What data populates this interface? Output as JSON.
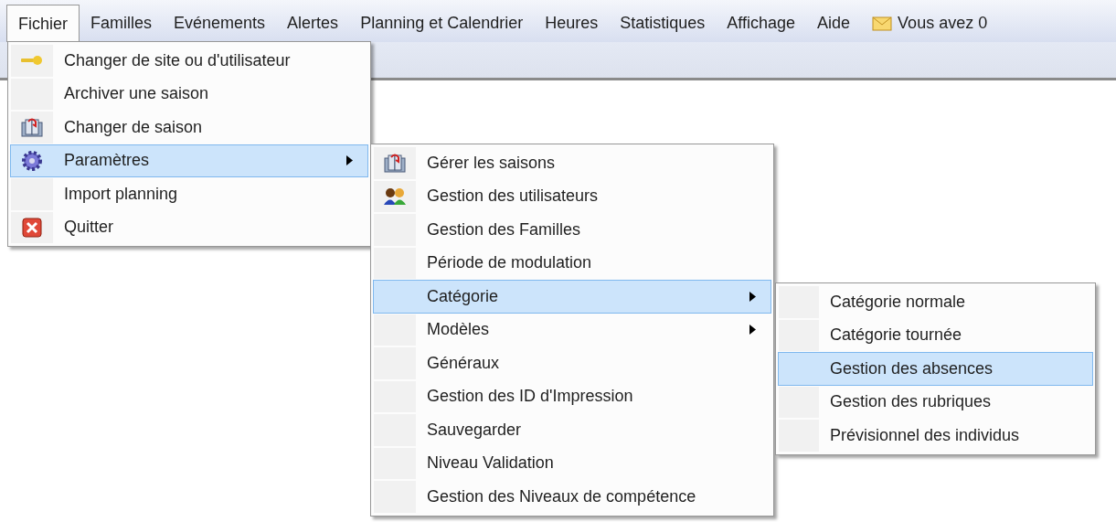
{
  "menubar": [
    {
      "label": "Fichier",
      "selected": true,
      "kind": "plain"
    },
    {
      "label": "Familles",
      "selected": false,
      "kind": "plain"
    },
    {
      "label": "Evénements",
      "selected": false,
      "kind": "plain"
    },
    {
      "label": "Alertes",
      "selected": false,
      "kind": "plain"
    },
    {
      "label": "Planning et Calendrier",
      "selected": false,
      "kind": "plain"
    },
    {
      "label": "Heures",
      "selected": false,
      "kind": "plain"
    },
    {
      "label": "Statistiques",
      "selected": false,
      "kind": "plain"
    },
    {
      "label": "Affichage",
      "selected": false,
      "kind": "plain"
    },
    {
      "label": "Aide",
      "selected": false,
      "kind": "plain"
    },
    {
      "label": "Vous avez 0",
      "selected": false,
      "kind": "mail"
    }
  ],
  "menus": [
    {
      "items": [
        {
          "label": "Changer de site ou d'utilisateur",
          "selected": false,
          "submenu": false,
          "kind": "key"
        },
        {
          "label": "Archiver une saison",
          "selected": false,
          "submenu": false,
          "kind": "plain"
        },
        {
          "label": "Changer de saison",
          "selected": false,
          "submenu": false,
          "kind": "book"
        },
        {
          "label": "Paramètres",
          "selected": true,
          "submenu": true,
          "kind": "gear"
        },
        {
          "label": "Import planning",
          "selected": false,
          "submenu": false,
          "kind": "plain"
        },
        {
          "label": "Quitter",
          "selected": false,
          "submenu": false,
          "kind": "close"
        }
      ]
    },
    {
      "items": [
        {
          "label": "Gérer les saisons",
          "selected": false,
          "submenu": false,
          "kind": "book"
        },
        {
          "label": "Gestion des utilisateurs",
          "selected": false,
          "submenu": false,
          "kind": "users"
        },
        {
          "label": "Gestion des Familles",
          "selected": false,
          "submenu": false,
          "kind": "plain"
        },
        {
          "label": "Période de modulation",
          "selected": false,
          "submenu": false,
          "kind": "plain"
        },
        {
          "label": "Catégorie",
          "selected": true,
          "submenu": true,
          "kind": "plain"
        },
        {
          "label": "Modèles",
          "selected": false,
          "submenu": true,
          "kind": "plain"
        },
        {
          "label": "Généraux",
          "selected": false,
          "submenu": false,
          "kind": "plain"
        },
        {
          "label": "Gestion des ID d'Impression",
          "selected": false,
          "submenu": false,
          "kind": "plain"
        },
        {
          "label": "Sauvegarder",
          "selected": false,
          "submenu": false,
          "kind": "plain"
        },
        {
          "label": "Niveau Validation",
          "selected": false,
          "submenu": false,
          "kind": "plain"
        },
        {
          "label": "Gestion des Niveaux de compétence",
          "selected": false,
          "submenu": false,
          "kind": "plain"
        }
      ]
    },
    {
      "items": [
        {
          "label": "Catégorie normale",
          "selected": false,
          "submenu": false,
          "kind": "plain"
        },
        {
          "label": "Catégorie tournée",
          "selected": false,
          "submenu": false,
          "kind": "plain"
        },
        {
          "label": "Gestion des absences",
          "selected": true,
          "submenu": false,
          "kind": "plain"
        },
        {
          "label": "Gestion des rubriques",
          "selected": false,
          "submenu": false,
          "kind": "plain"
        },
        {
          "label": "Prévisionnel des individus",
          "selected": false,
          "submenu": false,
          "kind": "plain"
        }
      ]
    }
  ]
}
